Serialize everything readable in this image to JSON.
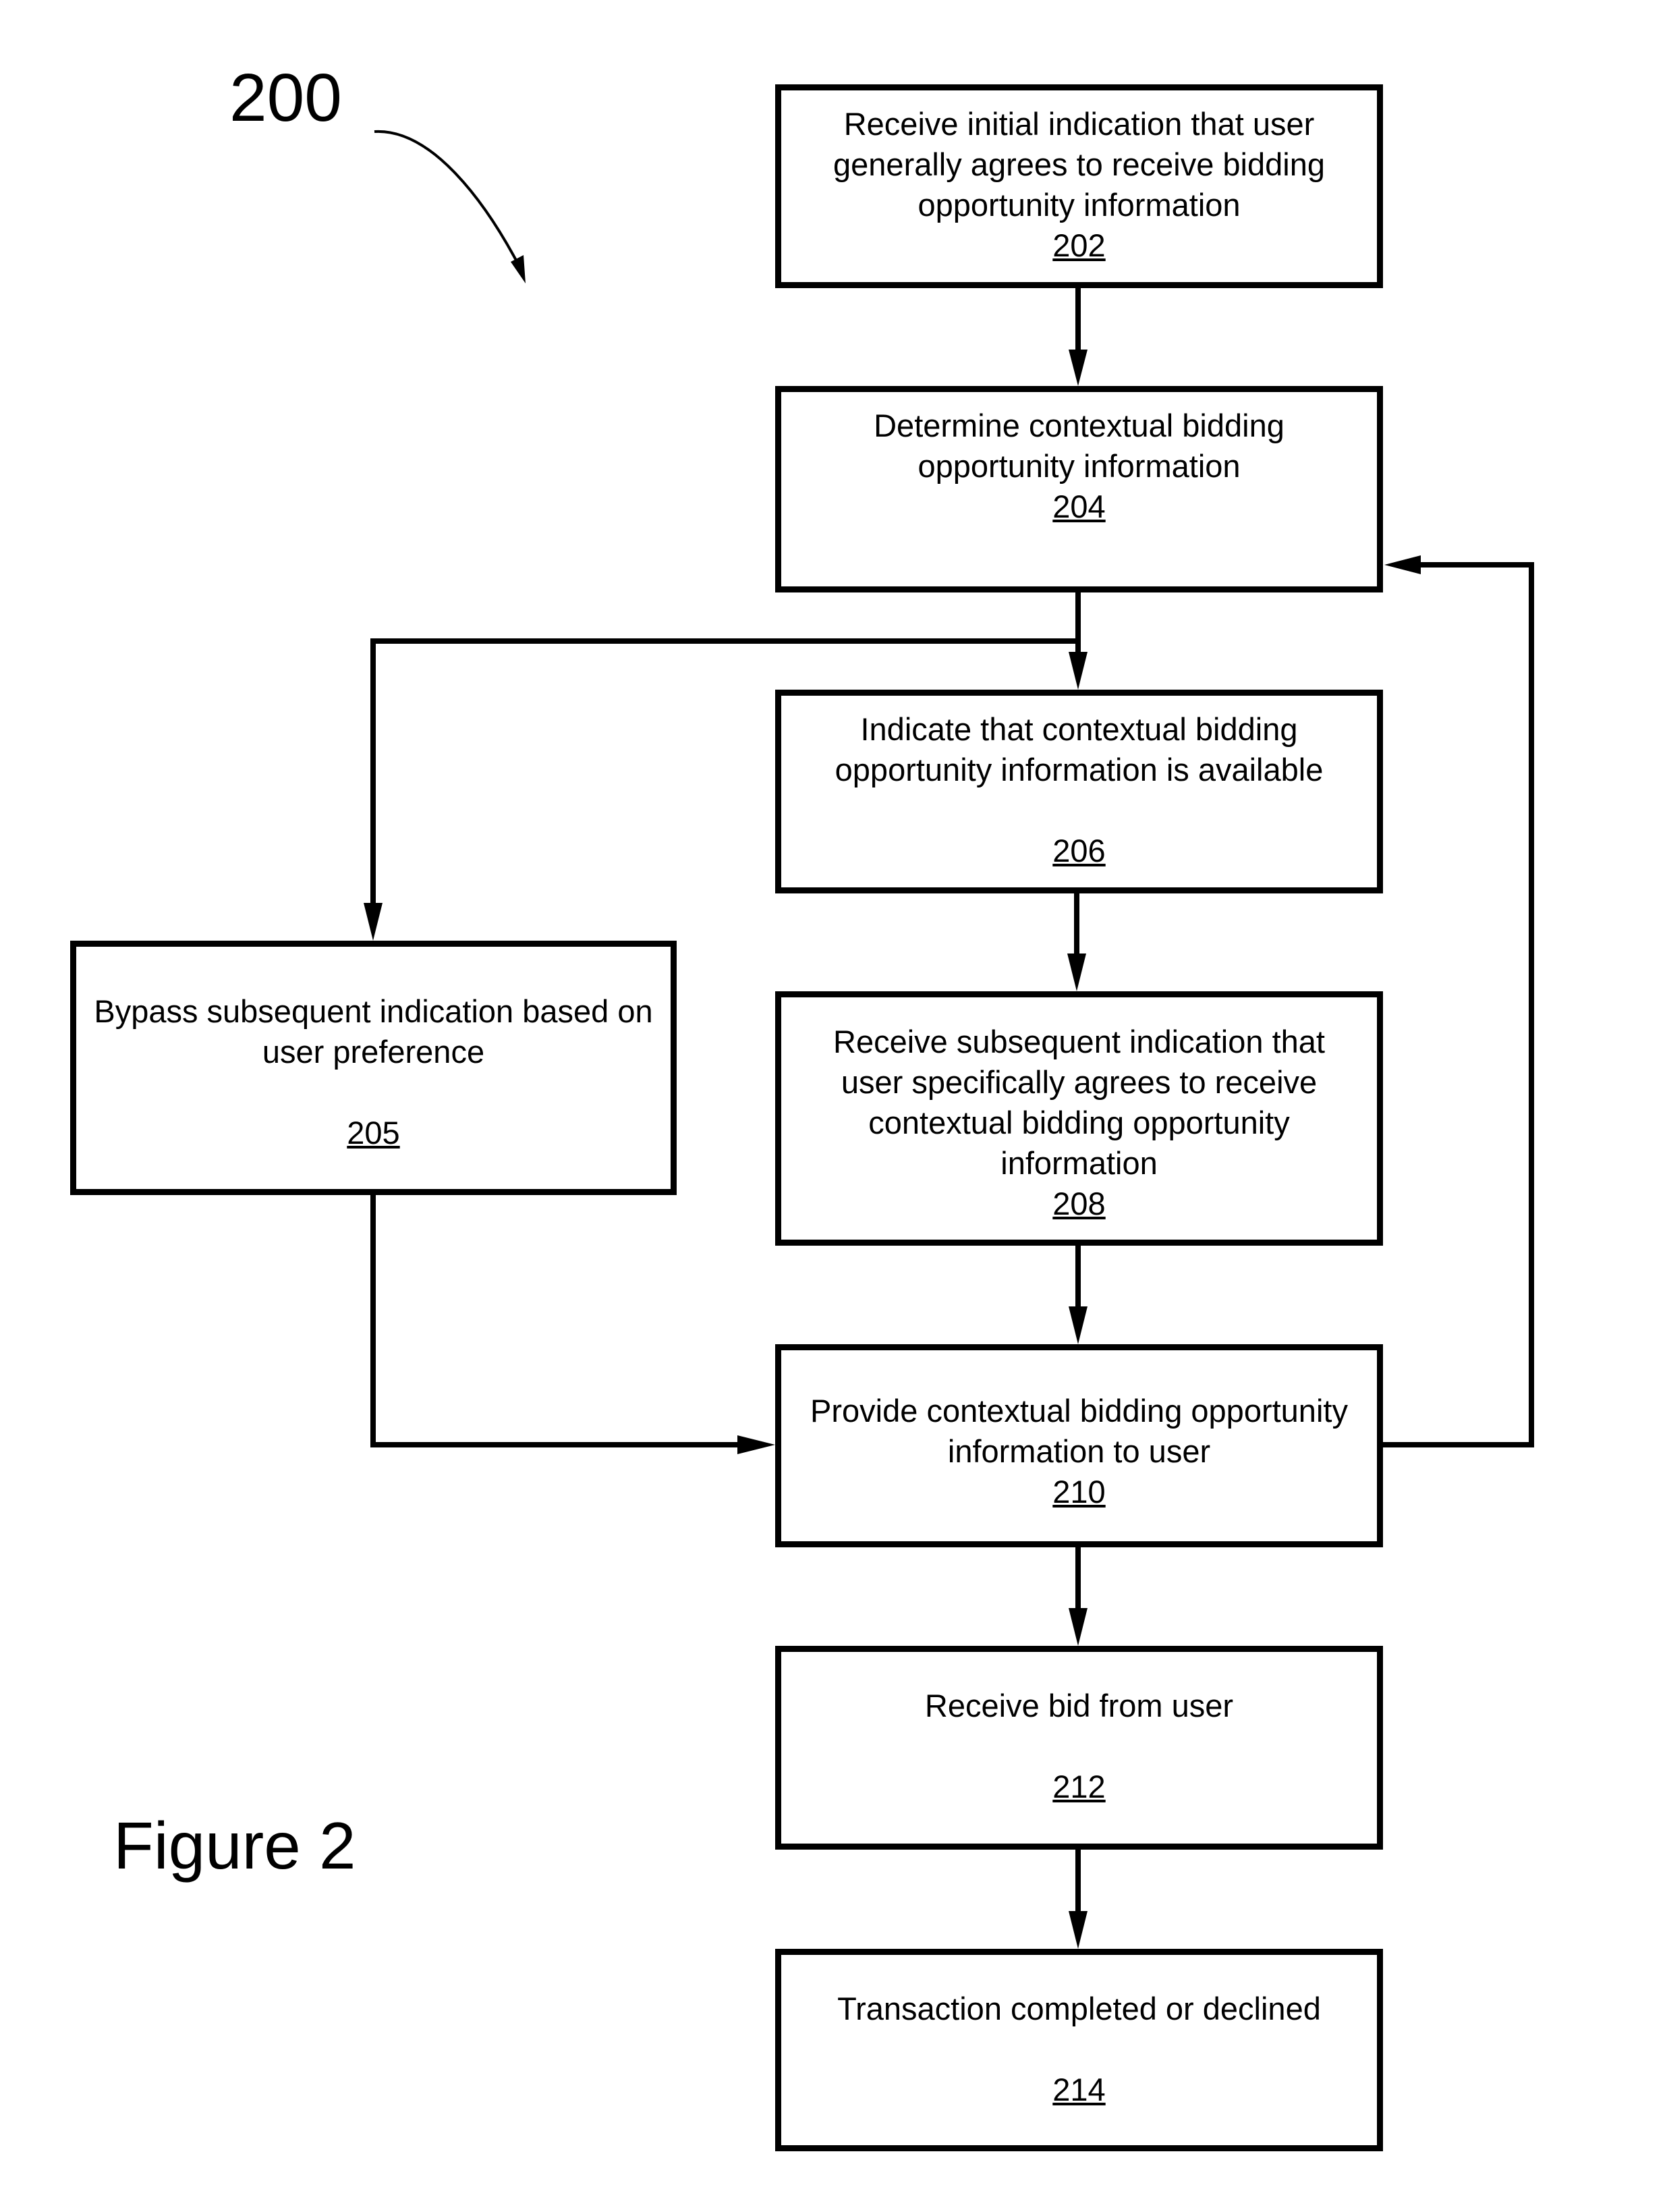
{
  "figure": {
    "number_label": "200",
    "caption": "Figure 2"
  },
  "steps": {
    "s202": {
      "text": "Receive initial indication that user generally agrees to receive bidding opportunity information",
      "ref": "202"
    },
    "s204": {
      "text": "Determine contextual bidding opportunity information",
      "ref": "204"
    },
    "s205": {
      "text": "Bypass subsequent indication based on user preference",
      "ref": "205"
    },
    "s206": {
      "text": "Indicate that contextual bidding opportunity information is available",
      "ref": "206"
    },
    "s208": {
      "text": "Receive subsequent indication that user specifically agrees to receive contextual bidding opportunity information",
      "ref": "208"
    },
    "s210": {
      "text": "Provide contextual bidding opportunity information to user",
      "ref": "210"
    },
    "s212": {
      "text": "Receive bid from user",
      "ref": "212"
    },
    "s214": {
      "text": "Transaction completed or declined",
      "ref": "214"
    }
  },
  "edges": [
    {
      "from": "202",
      "to": "204"
    },
    {
      "from": "204",
      "to": "206"
    },
    {
      "from": "204",
      "to": "205"
    },
    {
      "from": "206",
      "to": "208"
    },
    {
      "from": "208",
      "to": "210"
    },
    {
      "from": "205",
      "to": "210"
    },
    {
      "from": "210",
      "to": "204"
    },
    {
      "from": "210",
      "to": "212"
    },
    {
      "from": "212",
      "to": "214"
    }
  ]
}
